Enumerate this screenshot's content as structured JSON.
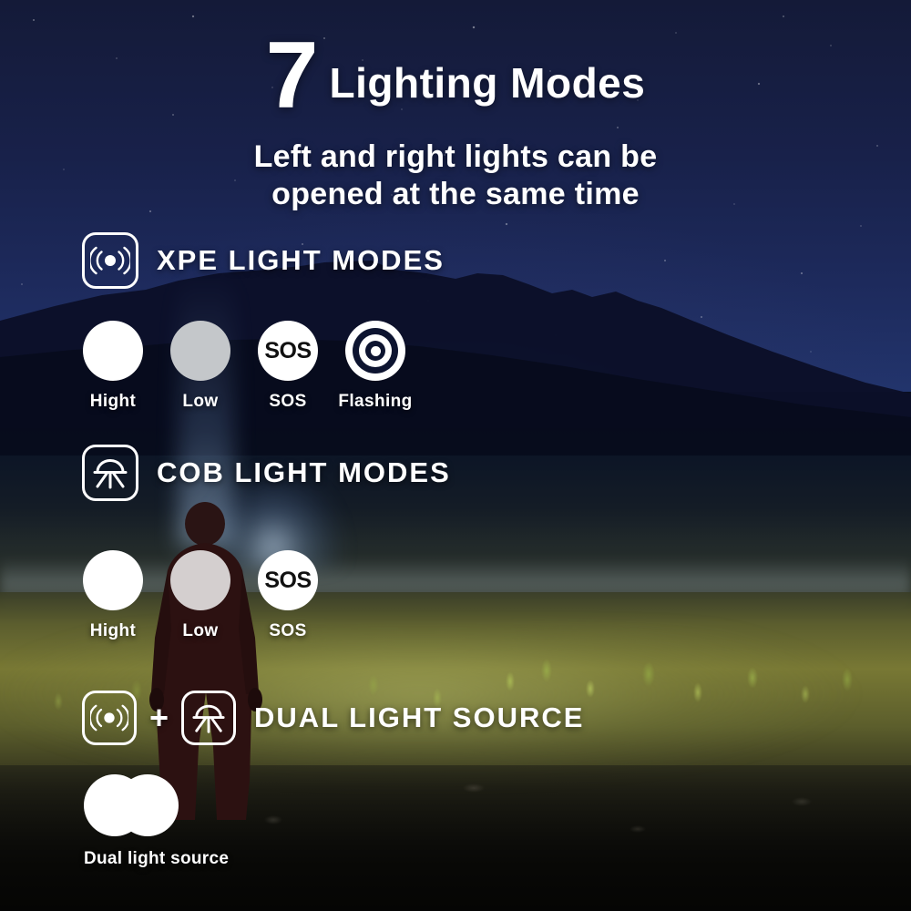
{
  "header": {
    "count": "7",
    "title": "Lighting Modes",
    "subtitle_line1": "Left and right lights can be",
    "subtitle_line2": "opened at the same time"
  },
  "sections": [
    {
      "id": "xpe",
      "icon": "xpe-signal-icon",
      "label": "XPE LIGHT MODES",
      "modes": [
        {
          "label": "Hight",
          "style": "solid-white",
          "glyph": ""
        },
        {
          "label": "Low",
          "style": "gray",
          "glyph": ""
        },
        {
          "label": "SOS",
          "style": "white-text",
          "glyph": "SOS"
        },
        {
          "label": "Flashing",
          "style": "concentric",
          "glyph": ""
        }
      ]
    },
    {
      "id": "cob",
      "icon": "cob-dome-icon",
      "label": "COB LIGHT MODES",
      "modes": [
        {
          "label": "Hight",
          "style": "solid-white",
          "glyph": ""
        },
        {
          "label": "Low",
          "style": "soft-white",
          "glyph": ""
        },
        {
          "label": "SOS",
          "style": "white-text",
          "glyph": "SOS"
        }
      ]
    },
    {
      "id": "dual",
      "icon_left": "xpe-signal-icon",
      "plus": "+",
      "icon_right": "cob-dome-icon",
      "label": "DUAL LIGHT SOURCE",
      "modes": [
        {
          "label": "Dual light source",
          "style": "double-circle",
          "glyph": ""
        }
      ]
    }
  ],
  "colors": {
    "text": "#ffffff",
    "sky": "#18214a",
    "ground": "#787834",
    "dot_high": "#ffffff",
    "dot_low": "#c4c7ca",
    "dot_sos_text": "#111111"
  }
}
